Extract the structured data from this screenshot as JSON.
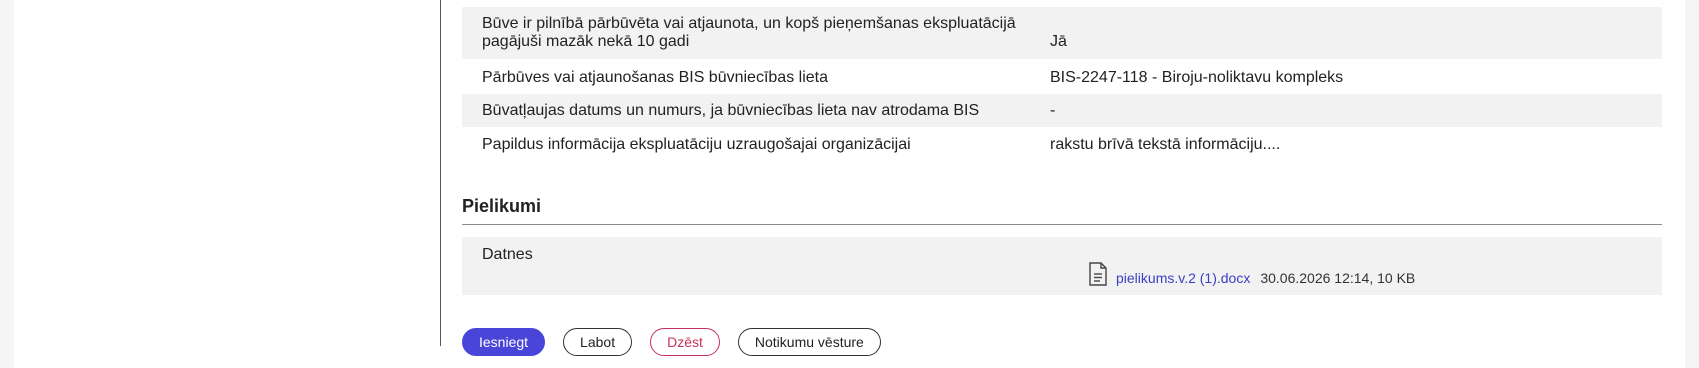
{
  "details": {
    "rows": [
      {
        "label": "Būve ir pilnībā pārbūvēta vai atjaunota, un kopš pieņemšanas ekspluatācijā pagājuši mazāk nekā 10 gadi",
        "value": "Jā"
      },
      {
        "label": "Pārbūves vai atjaunošanas BIS būvniecības lieta",
        "value": "BIS-2247-118 - Biroju-noliktavu kompleks"
      },
      {
        "label": "Būvatļaujas datums un numurs, ja būvniecības lieta nav atrodama BIS",
        "value": "-"
      },
      {
        "label": "Papildus informācija ekspluatāciju uzraugošajai organizācijai",
        "value": "rakstu brīvā tekstā informāciju...."
      }
    ]
  },
  "attachments": {
    "title": "Pielikumi",
    "files_label": "Datnes",
    "file": {
      "icon": "document-icon",
      "name": "pielikums.v.2 (1).docx",
      "meta": "30.06.2026 12:14, 10 KB"
    }
  },
  "actions": {
    "submit": "Iesniegt",
    "edit": "Labot",
    "delete": "Dzēst",
    "history": "Notikumu vēsture"
  },
  "colors": {
    "primary": "#4a45d9",
    "danger": "#c8325a",
    "link": "#3b3fc4"
  }
}
